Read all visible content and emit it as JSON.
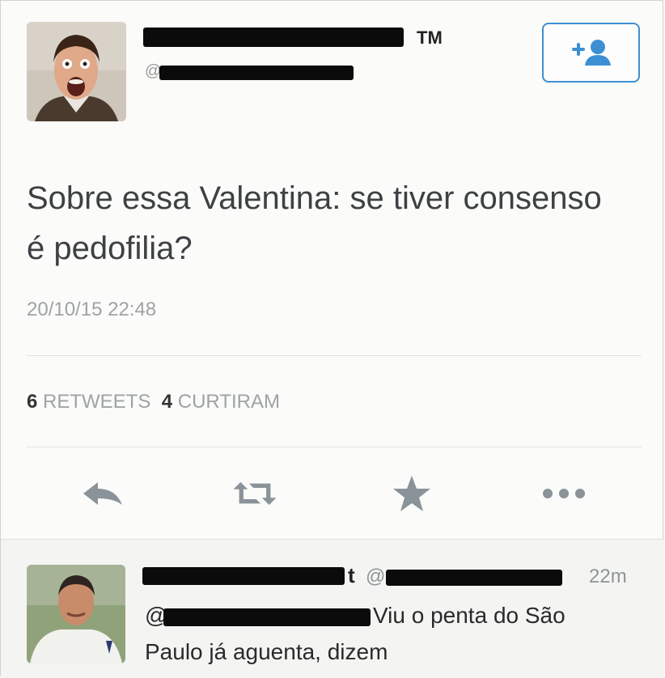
{
  "tweet": {
    "name_suffix": "TM",
    "handle_prefix": "@",
    "text": "Sobre essa Valentina: se tiver consenso é pedofilia?",
    "timestamp": "20/10/15 22:48",
    "retweets_count": "6",
    "retweets_label": "RETWEETS",
    "likes_count": "4",
    "likes_label": "CURTIRAM"
  },
  "icons": {
    "follow": "add-user-icon",
    "reply": "reply-icon",
    "retweet": "retweet-icon",
    "favorite": "star-icon",
    "more": "more-icon"
  },
  "reply": {
    "name_tail": "t",
    "handle_prefix": "@",
    "time": "22m",
    "mention_prefix": "@",
    "text_line1": "Viu o penta do São",
    "text_line2": "Paulo já aguenta, dizem"
  },
  "colors": {
    "accent": "#3d8fd4",
    "icon_gray": "#8a9399",
    "text_gray": "#9ea3a6"
  }
}
